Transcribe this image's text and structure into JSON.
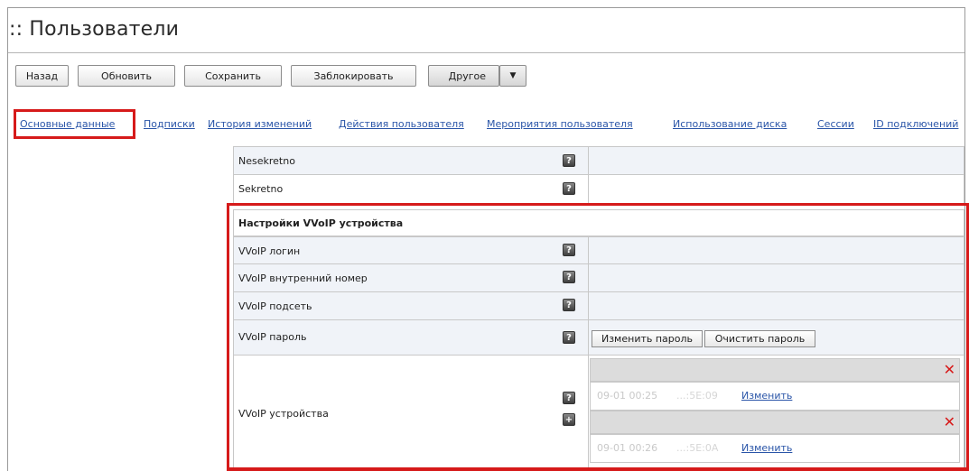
{
  "page": {
    "title": ":: Пользователи"
  },
  "toolbar": {
    "back": "Назад",
    "refresh": "Обновить",
    "save": "Сохранить",
    "block": "Заблокировать",
    "other": "Другое",
    "other_arrow": "▼"
  },
  "tabs": [
    "Основные данные",
    "Подписки",
    "История изменений",
    "Действия пользователя",
    "Мероприятия пользователя",
    "Использование диска",
    "Сессии",
    "ID подключений"
  ],
  "rows": {
    "nesekretno": "Nesekretno",
    "sekretno": "Sekretno"
  },
  "vvoip": {
    "section_title": "Настройки VVoIP устройства",
    "login": "VVoIP логин",
    "ext": "VVoIP внутренний номер",
    "subnet": "VVoIP подсеть",
    "password": "VVoIP пароль",
    "change_password": "Изменить пароль",
    "clear_password": "Очистить пароль",
    "devices": "VVoIP устройства",
    "device1": {
      "date": "09-01 00:25",
      "mac": "...:5E:09",
      "change": "Изменить"
    },
    "device2": {
      "date": "09-01 00:26",
      "mac": "...:5E:0A",
      "change": "Изменить"
    }
  },
  "icons": {
    "help": "?",
    "add": "+",
    "delete": "✕"
  },
  "colors": {
    "link": "#2a55a8",
    "highlight": "#d61a1a",
    "delete": "#d71a1a"
  }
}
